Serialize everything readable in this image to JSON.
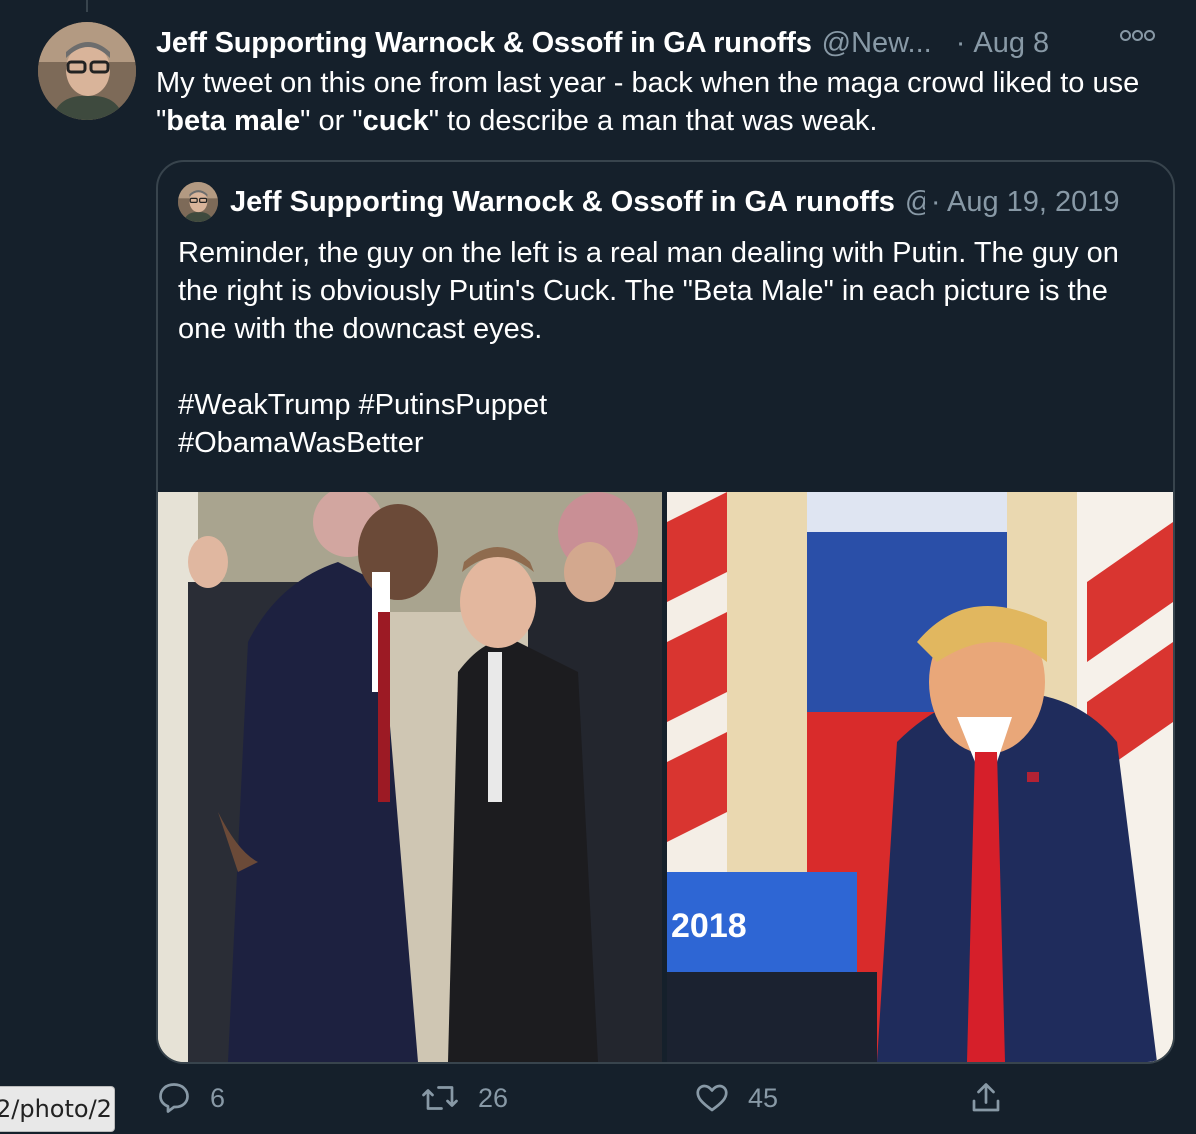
{
  "tweet": {
    "author_name": "Jeff Supporting Warnock & Ossoff in GA runoffs",
    "handle": "@New...",
    "date": "Aug 8",
    "text_part1": "My tweet on this one from last year - back when the maga crowd liked to use \"",
    "bold1": "beta male",
    "text_part2": "\" or \"",
    "bold2": "cuck",
    "text_part3": "\" to describe a man that was weak."
  },
  "quoted_tweet": {
    "author_name": "Jeff Supporting Warnock & Ossoff in GA runoffs",
    "handle": "@",
    "date": "· Aug 19, 2019",
    "text": "Reminder, the guy on the left is a real man dealing with Putin. The guy on the right is obviously Putin's Cuck. The \"Beta Male\" in each picture is the one with the downcast eyes.\n\n#WeakTrump #PutinsPuppet\n#ObamaWasBetter",
    "photo_right_sign": "2018"
  },
  "actions": {
    "reply_count": "6",
    "retweet_count": "26",
    "like_count": "45"
  },
  "tooltip": {
    "url_fragment": "2/photo/2"
  },
  "colors": {
    "background": "#15202b",
    "border": "#38444d",
    "secondary_text": "#8899a6"
  },
  "icons": [
    "more-icon",
    "reply-icon",
    "retweet-icon",
    "like-icon",
    "share-icon"
  ]
}
